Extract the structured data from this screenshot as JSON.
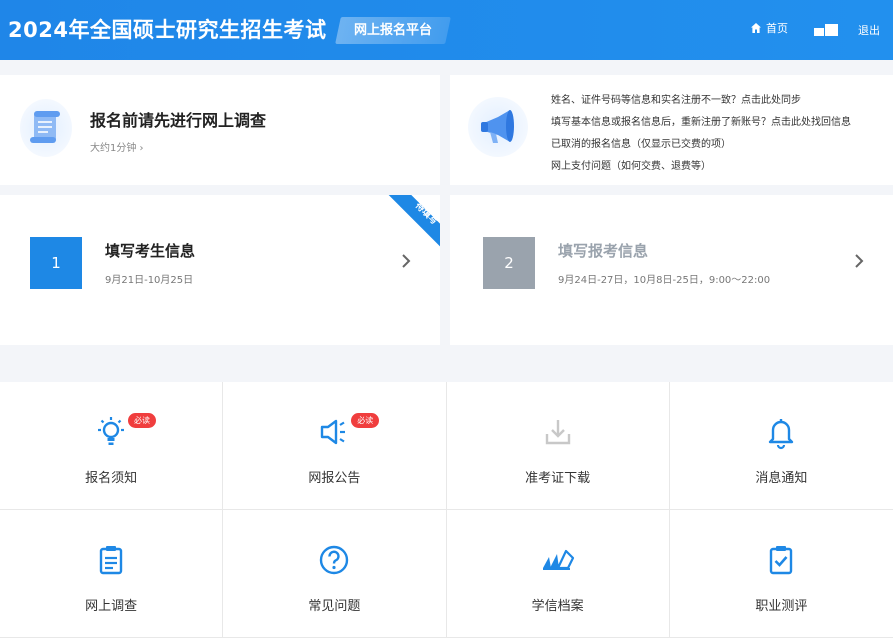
{
  "header": {
    "title": "2024年全国硕士研究生招生考试",
    "platform": "网上报名平台",
    "nav_home": "首页",
    "nav_logout": "退出"
  },
  "survey": {
    "title": "报名前请先进行网上调查",
    "subtitle": "大约1分钟 ›"
  },
  "faq": {
    "items": [
      "姓名、证件号码等信息和实名注册不一致？点击此处同步",
      "填写基本信息或报名信息后，重新注册了新账号？点击此处找回信息",
      "已取消的报名信息（仅显示已交费的项）",
      "网上支付问题（如何交费、退费等）"
    ]
  },
  "steps": [
    {
      "num": "1",
      "title": "填写考生信息",
      "date": "9月21日-10月25日",
      "badge": "待填写"
    },
    {
      "num": "2",
      "title": "填写报考信息",
      "date": "9月24日-27日，10月8日-25日，9:00～22:00"
    }
  ],
  "grid": [
    {
      "label": "报名须知",
      "badge": "必读",
      "icon": "lightbulb-icon"
    },
    {
      "label": "网报公告",
      "badge": "必读",
      "icon": "speaker-icon"
    },
    {
      "label": "准考证下载",
      "icon": "download-icon"
    },
    {
      "label": "消息通知",
      "icon": "bell-icon"
    },
    {
      "label": "网上调查",
      "icon": "clipboard-icon"
    },
    {
      "label": "常见问题",
      "icon": "question-icon"
    },
    {
      "label": "学信档案",
      "icon": "archive-icon"
    },
    {
      "label": "职业测评",
      "icon": "clipboard-check-icon"
    }
  ],
  "colors": {
    "primary": "#1e88e5",
    "muted": "#9aa3ad",
    "badge": "#f03e3e",
    "disabled_icon": "#c8c8c8"
  }
}
